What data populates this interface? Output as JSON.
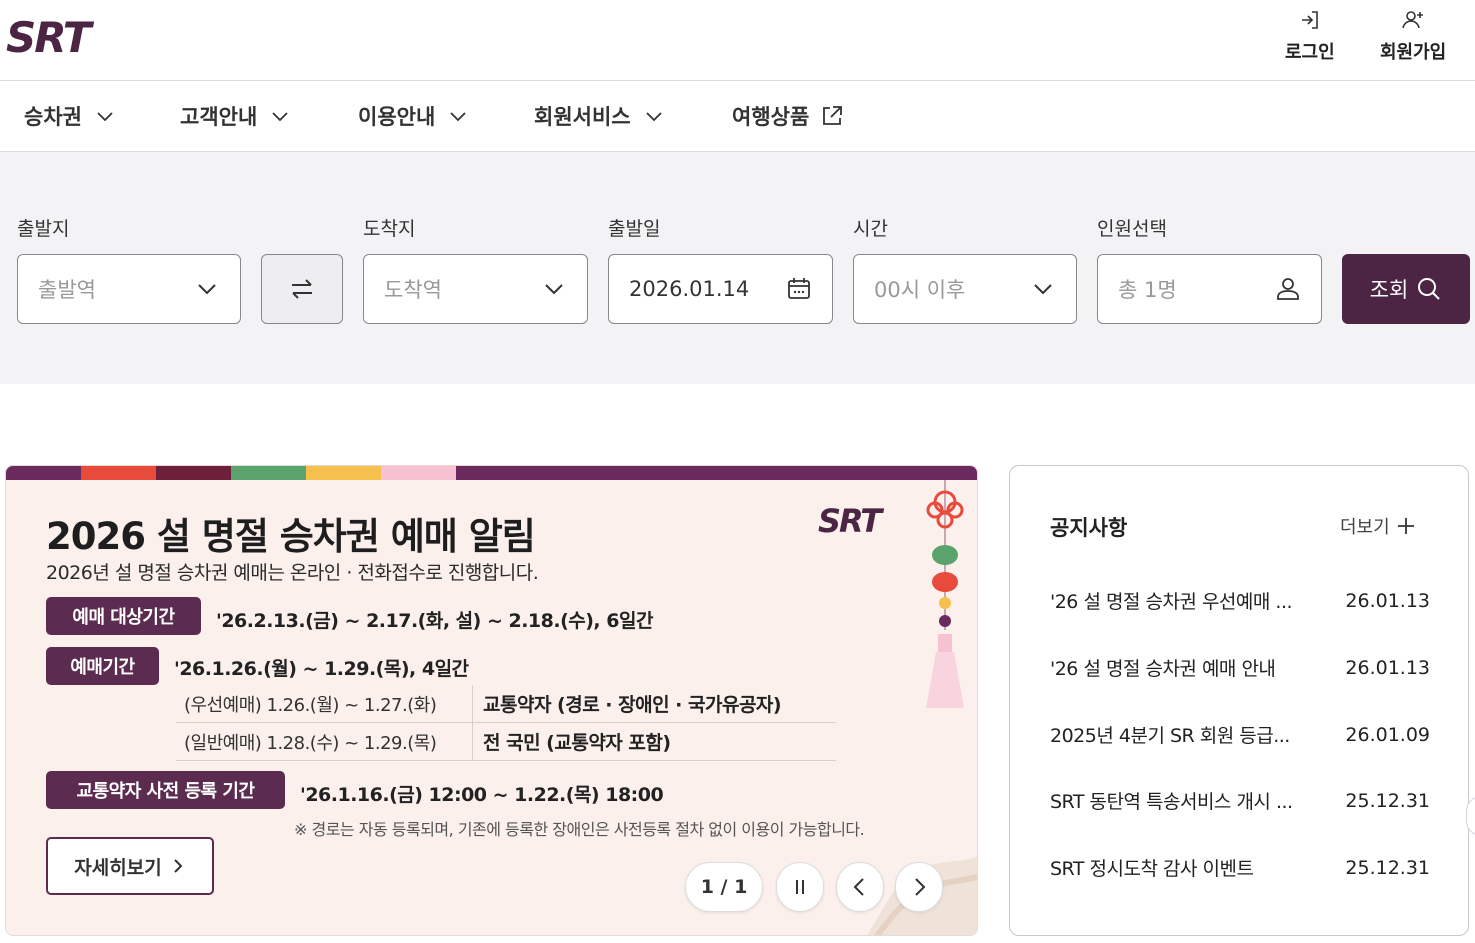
{
  "header": {
    "logo_text": "SRT",
    "login_label": "로그인",
    "join_label": "회원가입"
  },
  "gnb": {
    "items": [
      {
        "label": "승차권",
        "icon": "chevron-down-icon"
      },
      {
        "label": "고객안내",
        "icon": "chevron-down-icon"
      },
      {
        "label": "이용안내",
        "icon": "chevron-down-icon"
      },
      {
        "label": "회원서비스",
        "icon": "chevron-down-icon"
      },
      {
        "label": "여행상품",
        "icon": "external-link-icon"
      }
    ]
  },
  "search": {
    "departure": {
      "label": "출발지",
      "placeholder": "출발역"
    },
    "arrival": {
      "label": "도착지",
      "placeholder": "도착역"
    },
    "date": {
      "label": "출발일",
      "value": "2026.01.14"
    },
    "time": {
      "label": "시간",
      "value": "00시 이후"
    },
    "passengers": {
      "label": "인원선택",
      "value": "총 1명"
    },
    "search_button": "조회"
  },
  "banner": {
    "logo_text": "SRT",
    "title": "2026 설 명절 승차권 예매 알림",
    "subtitle": "2026년 설 명절 승차권 예매는 온라인 · 전화접수로 진행합니다.",
    "period_target_label": "예매 대상기간",
    "period_target_value": "'26.2.13.(금) ~ 2.17.(화, 설) ~ 2.18.(수), 6일간",
    "period_label": "예매기간",
    "period_value": "'26.1.26.(월) ~ 1.29.(목), 4일간",
    "rows": [
      {
        "when": "(우선예매) 1.26.(월) ~ 1.27.(화)",
        "who": "교통약자 (경로 · 장애인 · 국가유공자)"
      },
      {
        "when": "(일반예매) 1.28.(수) ~ 1.29.(목)",
        "who": "전 국민 (교통약자 포함)"
      }
    ],
    "preregister_label": "교통약자 사전 등록 기간",
    "preregister_value": "'26.1.16.(금) 12:00 ~ 1.22.(목) 18:00",
    "note": "※ 경로는 자동 등록되며, 기존에 등록한 장애인은 사전등록 절차 없이 이용이 가능합니다.",
    "detail_button": "자세히보기",
    "page_indicator": "1 / 1",
    "stripe_colors": [
      "#6a2a5e",
      "#e84a3b",
      "#6e1f3a",
      "#5aa36d",
      "#f5c04e",
      "#f6c1d0",
      "#6a2a5e"
    ]
  },
  "notice": {
    "title": "공지사항",
    "more_label": "더보기",
    "items": [
      {
        "title": "'26 설 명절 승차권 우선예매 ...",
        "date": "26.01.13"
      },
      {
        "title": "'26 설 명절 승차권 예매 안내",
        "date": "26.01.13"
      },
      {
        "title": "2025년 4분기 SR 회원 등급...",
        "date": "26.01.09"
      },
      {
        "title": "SRT 동탄역 특송서비스 개시 ...",
        "date": "25.12.31"
      },
      {
        "title": "SRT 정시도착 감사 이벤트",
        "date": "25.12.31"
      }
    ]
  },
  "colors": {
    "brand": "#4b2543",
    "pill": "#5b2c4f",
    "search_bg": "#f3f3f5",
    "banner_bg": "#fbf0ec"
  }
}
